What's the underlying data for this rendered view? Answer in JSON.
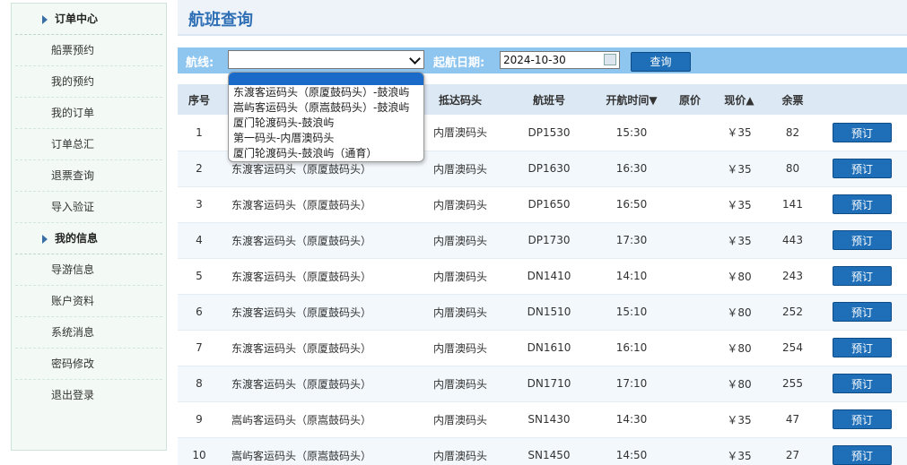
{
  "sidebar": {
    "sections": [
      {
        "label": "订单中心",
        "items": [
          "船票预约",
          "我的预约",
          "我的订单",
          "订单总汇",
          "退票查询",
          "导入验证"
        ]
      },
      {
        "label": "我的信息",
        "items": [
          "导游信息",
          "账户资料",
          "系统消息",
          "密码修改",
          "退出登录"
        ]
      }
    ]
  },
  "header": {
    "title": "航班查询"
  },
  "search": {
    "route_label": "航线:",
    "route_value": "",
    "date_label": "起航日期:",
    "date_value": "2024-10-30",
    "query_button": "查询"
  },
  "route_dropdown": {
    "options": [
      "东渡客运码头（原厦鼓码头）-鼓浪屿",
      "嵩屿客运码头（原嵩鼓码头）-鼓浪屿",
      "厦门轮渡码头-鼓浪屿",
      "第一码头-内厝澳码头",
      "厦门轮渡码头-鼓浪屿（通育）"
    ]
  },
  "table": {
    "headers": {
      "no": "序号",
      "departure": "",
      "arrival": "抵达码头",
      "flight": "航班号",
      "time": "开航时间▼",
      "original_price": "原价",
      "current_price": "现价▲",
      "remaining": "余票",
      "action": ""
    },
    "book_label": "预订",
    "rows": [
      {
        "no": "1",
        "departure": "",
        "arrival": "内厝澳码头",
        "flight": "DP1530",
        "time": "15:30",
        "original_price": "",
        "current_price": "￥35",
        "remaining": "82"
      },
      {
        "no": "2",
        "departure": "东渡客运码头（原厦鼓码头）",
        "arrival": "内厝澳码头",
        "flight": "DP1630",
        "time": "16:30",
        "original_price": "",
        "current_price": "￥35",
        "remaining": "80"
      },
      {
        "no": "3",
        "departure": "东渡客运码头（原厦鼓码头）",
        "arrival": "内厝澳码头",
        "flight": "DP1650",
        "time": "16:50",
        "original_price": "",
        "current_price": "￥35",
        "remaining": "141"
      },
      {
        "no": "4",
        "departure": "东渡客运码头（原厦鼓码头）",
        "arrival": "内厝澳码头",
        "flight": "DP1730",
        "time": "17:30",
        "original_price": "",
        "current_price": "￥35",
        "remaining": "443"
      },
      {
        "no": "5",
        "departure": "东渡客运码头（原厦鼓码头）",
        "arrival": "内厝澳码头",
        "flight": "DN1410",
        "time": "14:10",
        "original_price": "",
        "current_price": "￥80",
        "remaining": "243"
      },
      {
        "no": "6",
        "departure": "东渡客运码头（原厦鼓码头）",
        "arrival": "内厝澳码头",
        "flight": "DN1510",
        "time": "15:10",
        "original_price": "",
        "current_price": "￥80",
        "remaining": "252"
      },
      {
        "no": "7",
        "departure": "东渡客运码头（原厦鼓码头）",
        "arrival": "内厝澳码头",
        "flight": "DN1610",
        "time": "16:10",
        "original_price": "",
        "current_price": "￥80",
        "remaining": "254"
      },
      {
        "no": "8",
        "departure": "东渡客运码头（原厦鼓码头）",
        "arrival": "内厝澳码头",
        "flight": "DN1710",
        "time": "17:10",
        "original_price": "",
        "current_price": "￥80",
        "remaining": "255"
      },
      {
        "no": "9",
        "departure": "嵩屿客运码头（原嵩鼓码头）",
        "arrival": "内厝澳码头",
        "flight": "SN1430",
        "time": "14:30",
        "original_price": "",
        "current_price": "￥35",
        "remaining": "47"
      },
      {
        "no": "10",
        "departure": "嵩屿客运码头（原嵩鼓码头）",
        "arrival": "内厝澳码头",
        "flight": "SN1450",
        "time": "14:50",
        "original_price": "",
        "current_price": "￥35",
        "remaining": "27"
      }
    ]
  }
}
